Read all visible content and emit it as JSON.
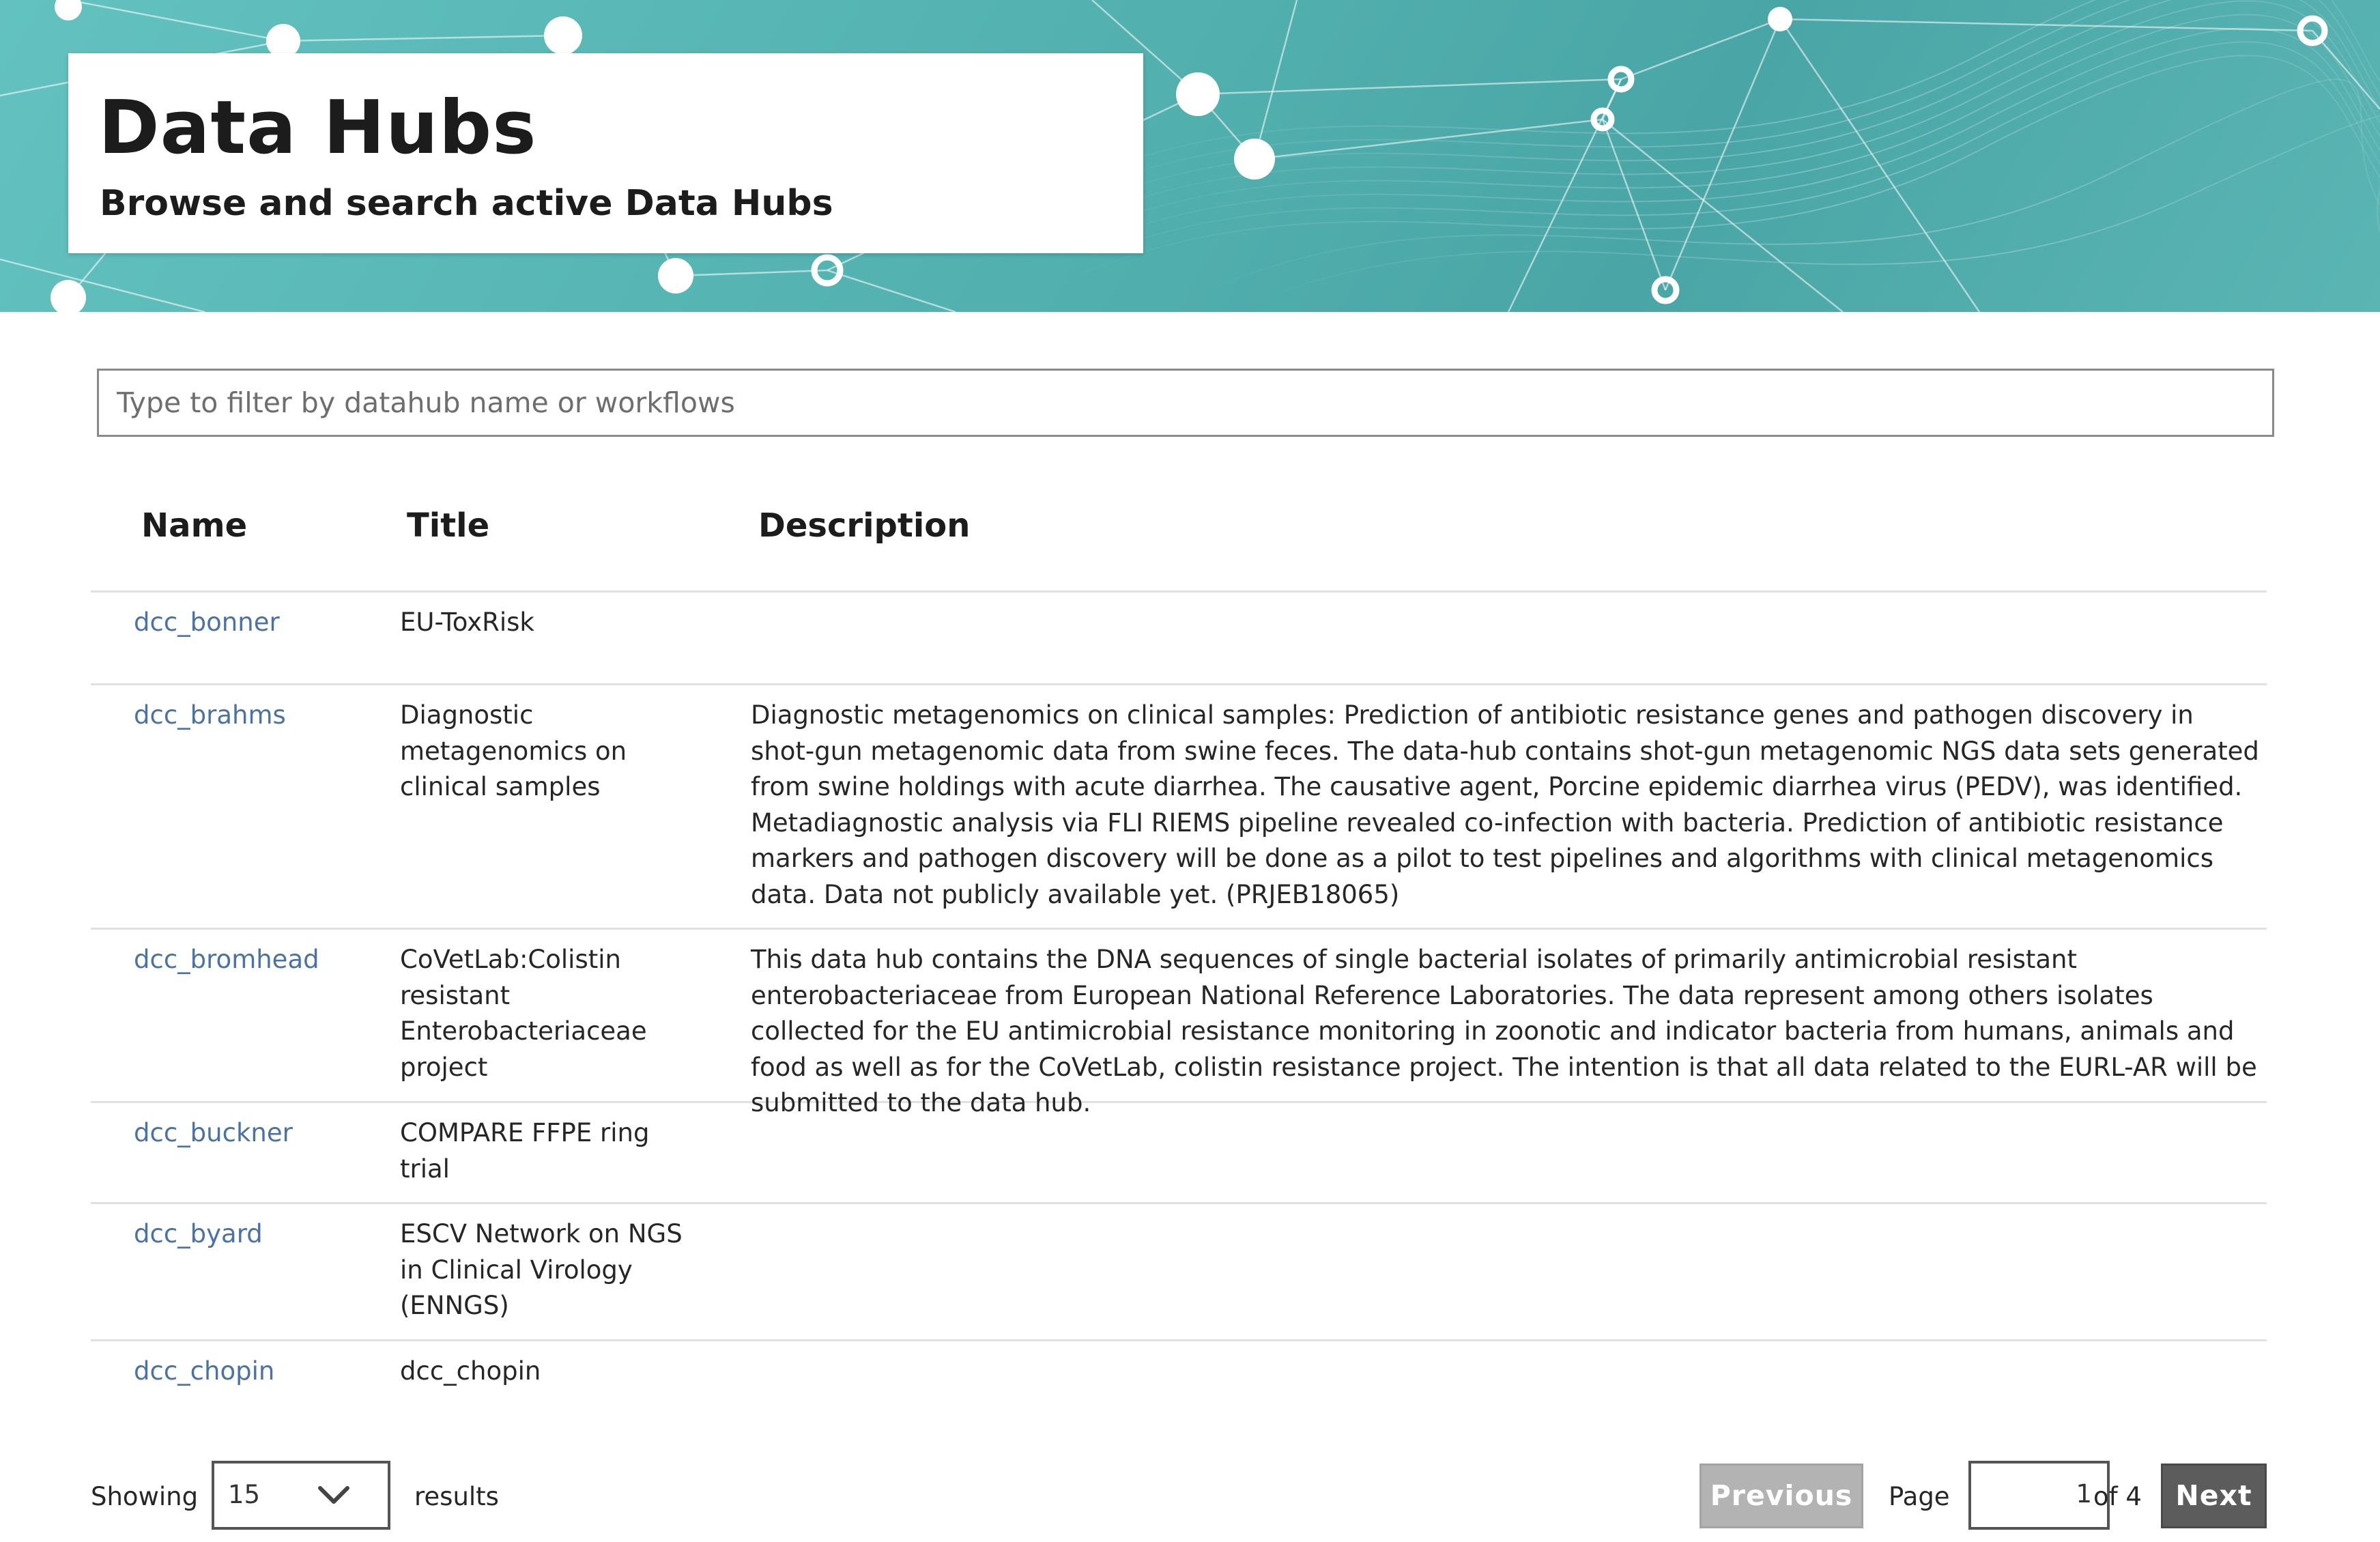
{
  "header": {
    "title": "Data Hubs",
    "subtitle": "Browse and search active Data Hubs"
  },
  "filter": {
    "placeholder": "Type to filter by datahub name or workflows",
    "value": ""
  },
  "table": {
    "columns": [
      "Name",
      "Title",
      "Description"
    ],
    "rows": [
      {
        "name": "dcc_bonner",
        "title": "EU-ToxRisk",
        "description": ""
      },
      {
        "name": "dcc_brahms",
        "title": "Diagnostic metagenomics on clinical samples",
        "description": "Diagnostic metagenomics on clinical samples: Prediction of antibiotic resistance genes and pathogen discovery in shot-gun metagenomic data from swine feces. The data-hub contains shot-gun metagenomic NGS data sets generated from swine holdings with acute diarrhea. The causative agent, Porcine epidemic diarrhea virus (PEDV), was identified. Metadiagnostic analysis via FLI RIEMS pipeline revealed co-infection with bacteria. Prediction of antibiotic resistance markers and pathogen discovery will be done as a pilot to test pipelines and algorithms with clinical metagenomics data. Data not publicly available yet. (PRJEB18065)"
      },
      {
        "name": "dcc_bromhead",
        "title": "CoVetLab:Colistin resistant Enterobacteriaceae project",
        "description": "This data hub contains the DNA sequences of single bacterial isolates of primarily antimicrobial resistant enterobacteriaceae from European National Reference Laboratories. The data represent among others isolates collected for the EU antimicrobial resistance monitoring in zoonotic and indicator bacteria from humans, animals and food as well as for the CoVetLab, colistin resistance project. The intention is that all data related to the EURL-AR will be submitted to the data hub."
      },
      {
        "name": "dcc_buckner",
        "title": "COMPARE FFPE ring trial",
        "description": ""
      },
      {
        "name": "dcc_byard",
        "title": "ESCV Network on NGS in Clinical Virology (ENNGS)",
        "description": ""
      },
      {
        "name": "dcc_chopin",
        "title": "dcc_chopin",
        "description": ""
      }
    ]
  },
  "pagination": {
    "showing_label": "Showing",
    "page_size": "15",
    "results_label": "results",
    "previous_label": "Previous",
    "page_label": "Page",
    "current_page": "1",
    "of_label": "of 4",
    "next_label": "Next"
  },
  "colors": {
    "banner": "#55b5b3",
    "link": "#4a72a8",
    "next_button": "#5c5c5c",
    "previous_button_disabled": "#b3b3b3"
  },
  "icons": {
    "page_size_dropdown": "chevron-down-icon"
  }
}
